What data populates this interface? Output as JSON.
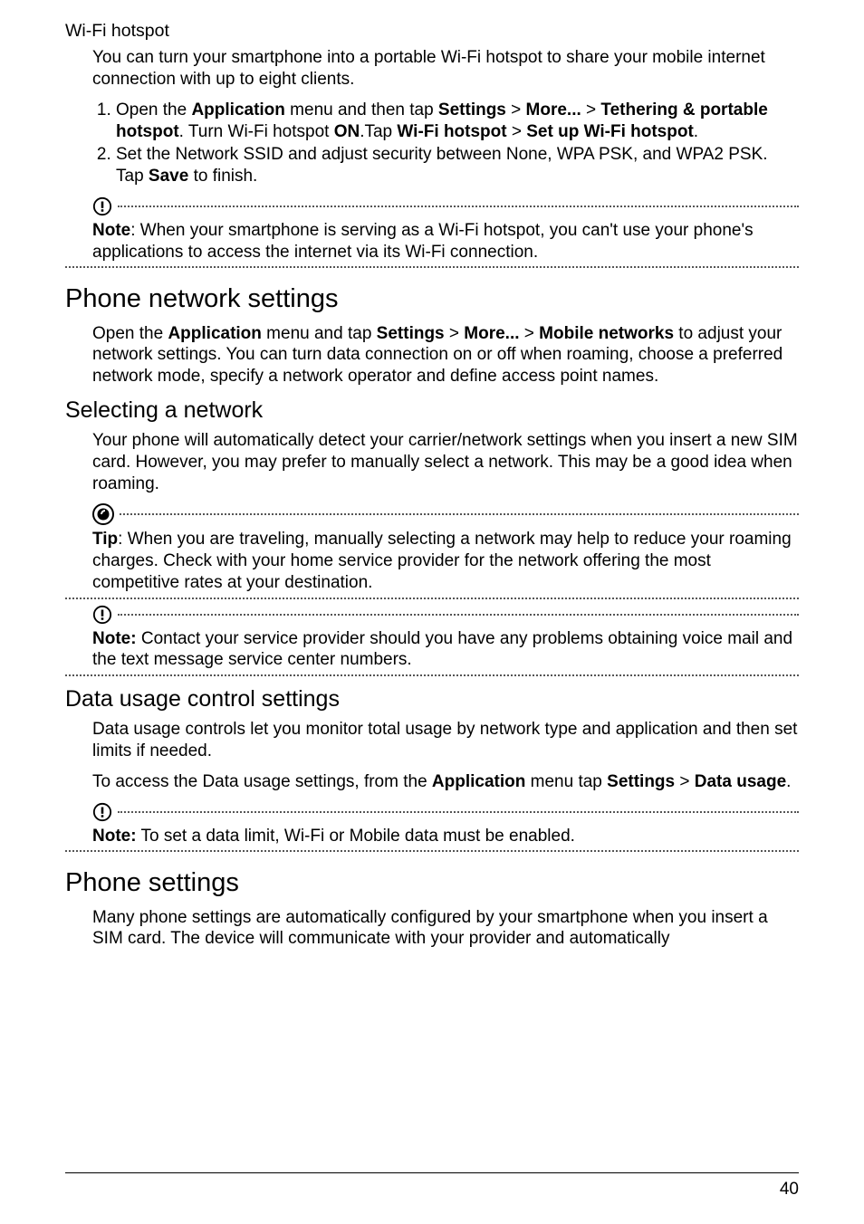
{
  "sections": {
    "wifi_hotspot": {
      "title": "Wi-Fi hotspot",
      "intro": "You can turn your smartphone into a portable Wi-Fi hotspot to share your mobile internet connection with up to eight clients.",
      "steps": [
        {
          "pre": "Open the ",
          "b1": "Application",
          "mid1": " menu and then tap ",
          "b2": "Settings",
          "mid2": " > ",
          "b3": "More...",
          "mid3": " > ",
          "b4": "Tethering & portable hotspot",
          "mid4": ". Turn Wi-Fi hotspot ",
          "b5": "ON",
          "mid5": ".Tap ",
          "b6": "Wi-Fi hotspot",
          "mid6": " > ",
          "b7": "Set up Wi-Fi hotspot",
          "post": "."
        },
        {
          "text_pre": "Set the Network SSID and adjust security between None, WPA PSK, and WPA2 PSK. Tap ",
          "text_b": "Save",
          "text_post": " to finish."
        }
      ],
      "note": {
        "b": "Note",
        "text": ": When your smartphone is serving as a Wi-Fi hotspot, you can't use your phone's applications to access the internet via its Wi-Fi connection."
      }
    },
    "phone_network": {
      "title": "Phone network settings",
      "para_pre": "Open the ",
      "b1": "Application",
      "mid1": " menu and tap ",
      "b2": "Settings",
      "mid2": " > ",
      "b3": "More...",
      "mid3": " > ",
      "b4": "Mobile networks",
      "para_post": " to adjust your network settings. You can turn data connection on or off when roaming, choose a preferred network mode, specify a network operator and define access point names."
    },
    "selecting_network": {
      "title": "Selecting a network",
      "para": "Your phone will automatically detect your carrier/network settings when you insert a new SIM card. However, you may prefer to manually select a network. This may be a good idea when roaming.",
      "tip": {
        "b": "Tip",
        "text": ": When you are traveling, manually selecting a network may help to reduce your roaming charges. Check with your home service provider for the network offering the most competitive rates at your destination."
      },
      "note": {
        "b": "Note:",
        "text": " Contact your service provider should you have any problems obtaining voice mail and the text message service center numbers."
      }
    },
    "data_usage": {
      "title": "Data usage control settings",
      "para1": "Data usage controls let you monitor total usage by network type and application and then set limits if needed.",
      "para2_pre": "To access the Data usage settings, from the ",
      "b1": "Application",
      "mid1": " menu tap ",
      "b2": "Settings",
      "mid2": " > ",
      "b3": "Data usage",
      "post": ".",
      "note": {
        "b": "Note:",
        "text": " To set a data limit, Wi-Fi or Mobile data must be enabled."
      }
    },
    "phone_settings": {
      "title": "Phone settings",
      "para": "Many phone settings are automatically configured by your smartphone when you insert a SIM card. The device will communicate with your provider and automatically"
    }
  },
  "page_number": "40"
}
